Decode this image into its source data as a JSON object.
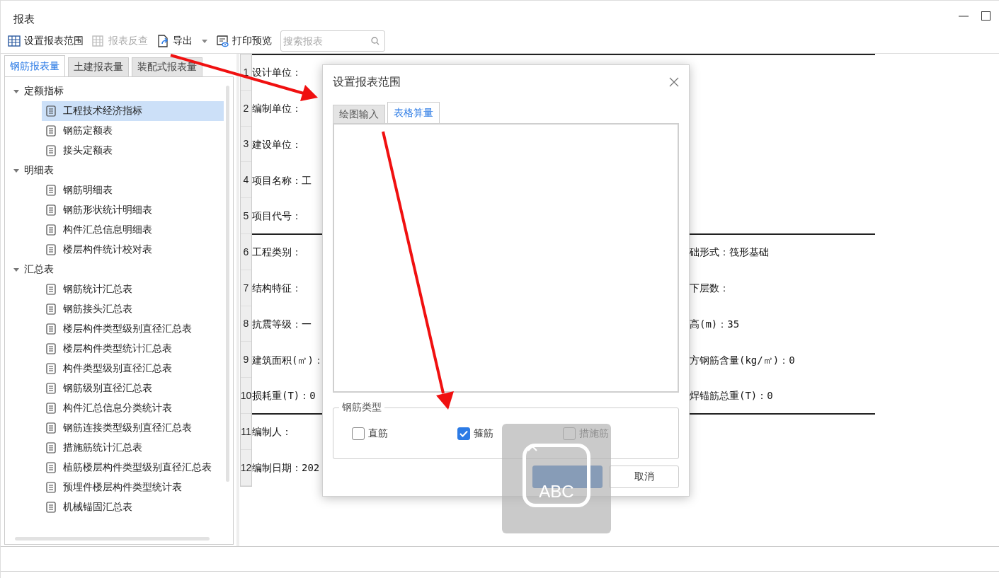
{
  "window": {
    "title": "报表"
  },
  "toolbar": [
    {
      "kind": "range",
      "label": "设置报表范围",
      "disabled": false
    },
    {
      "kind": "lookup",
      "label": "报表反查",
      "disabled": true
    },
    {
      "kind": "export",
      "label": "导出",
      "disabled": false
    },
    {
      "kind": "preview",
      "label": "打印预览",
      "disabled": false
    }
  ],
  "search": {
    "placeholder": "搜索报表"
  },
  "left_tabs": [
    {
      "label": "钢筋报表量",
      "selected": true
    },
    {
      "label": "土建报表量",
      "selected": false
    },
    {
      "label": "装配式报表量",
      "selected": false
    }
  ],
  "tree": [
    {
      "label": "定额指标",
      "expanded": true,
      "children": [
        {
          "label": "工程技术经济指标",
          "selected": true
        },
        {
          "label": "钢筋定额表",
          "selected": false
        },
        {
          "label": "接头定额表",
          "selected": false
        }
      ]
    },
    {
      "label": "明细表",
      "expanded": true,
      "children": [
        {
          "label": "钢筋明细表",
          "selected": false
        },
        {
          "label": "钢筋形状统计明细表",
          "selected": false
        },
        {
          "label": "构件汇总信息明细表",
          "selected": false
        },
        {
          "label": "楼层构件统计校对表",
          "selected": false
        }
      ]
    },
    {
      "label": "汇总表",
      "expanded": true,
      "children": [
        {
          "label": "钢筋统计汇总表",
          "selected": false
        },
        {
          "label": "钢筋接头汇总表",
          "selected": false
        },
        {
          "label": "楼层构件类型级别直径汇总表",
          "selected": false
        },
        {
          "label": "楼层构件类型统计汇总表",
          "selected": false
        },
        {
          "label": "构件类型级别直径汇总表",
          "selected": false
        },
        {
          "label": "钢筋级别直径汇总表",
          "selected": false
        },
        {
          "label": "构件汇总信息分类统计表",
          "selected": false
        },
        {
          "label": "钢筋连接类型级别直径汇总表",
          "selected": false
        },
        {
          "label": "措施筋统计汇总表",
          "selected": false
        },
        {
          "label": "植筋楼层构件类型级别直径汇总表",
          "selected": false
        },
        {
          "label": "预埋件楼层构件类型统计表",
          "selected": false
        },
        {
          "label": "机械锚固汇总表",
          "selected": false
        }
      ]
    }
  ],
  "report_rows": [
    {
      "number": "1",
      "left": "设计单位：",
      "rule_after": false
    },
    {
      "number": "2",
      "left": "编制单位：",
      "rule_after": false
    },
    {
      "number": "3",
      "left": "建设单位：",
      "rule_after": false
    },
    {
      "number": "4",
      "left": "项目名称：工",
      "rule_after": false
    },
    {
      "number": "5",
      "left": "项目代号：",
      "rule_after": true
    },
    {
      "number": "6",
      "left": "工程类别：",
      "right": "础形式：筏形基础",
      "rule_after": false
    },
    {
      "number": "7",
      "left": "结构特征：",
      "right": "下层数：",
      "rule_after": false
    },
    {
      "number": "8",
      "left": "抗震等级：一",
      "right": "高(m)：35",
      "rule_after": false
    },
    {
      "number": "9",
      "left": "建筑面积(㎡)：",
      "right": "方钢筋含量(kg/㎡)：0",
      "rule_after": false
    },
    {
      "number": "10",
      "left": "损耗重(T)：0",
      "right": "焊锚筋总重(T)：0",
      "rule_after": true
    },
    {
      "number": "11",
      "left": "编制人：",
      "rule_after": false
    },
    {
      "number": "12",
      "left": "编制日期：202",
      "rule_after": false
    }
  ],
  "dialog": {
    "title": "设置报表范围",
    "tabs": [
      {
        "label": "绘图输入",
        "selected": false
      },
      {
        "label": "表格算量",
        "selected": true
      }
    ],
    "group": {
      "title": "钢筋类型",
      "options": [
        {
          "label": "直筋",
          "checked": false
        },
        {
          "label": "箍筋",
          "checked": true
        },
        {
          "label": "措施筋",
          "checked": false
        }
      ]
    },
    "buttons": [
      {
        "kind": "primary"
      },
      {
        "kind": "secondary",
        "label": "取消"
      }
    ]
  },
  "input_indicator": {
    "label": "ABC"
  }
}
